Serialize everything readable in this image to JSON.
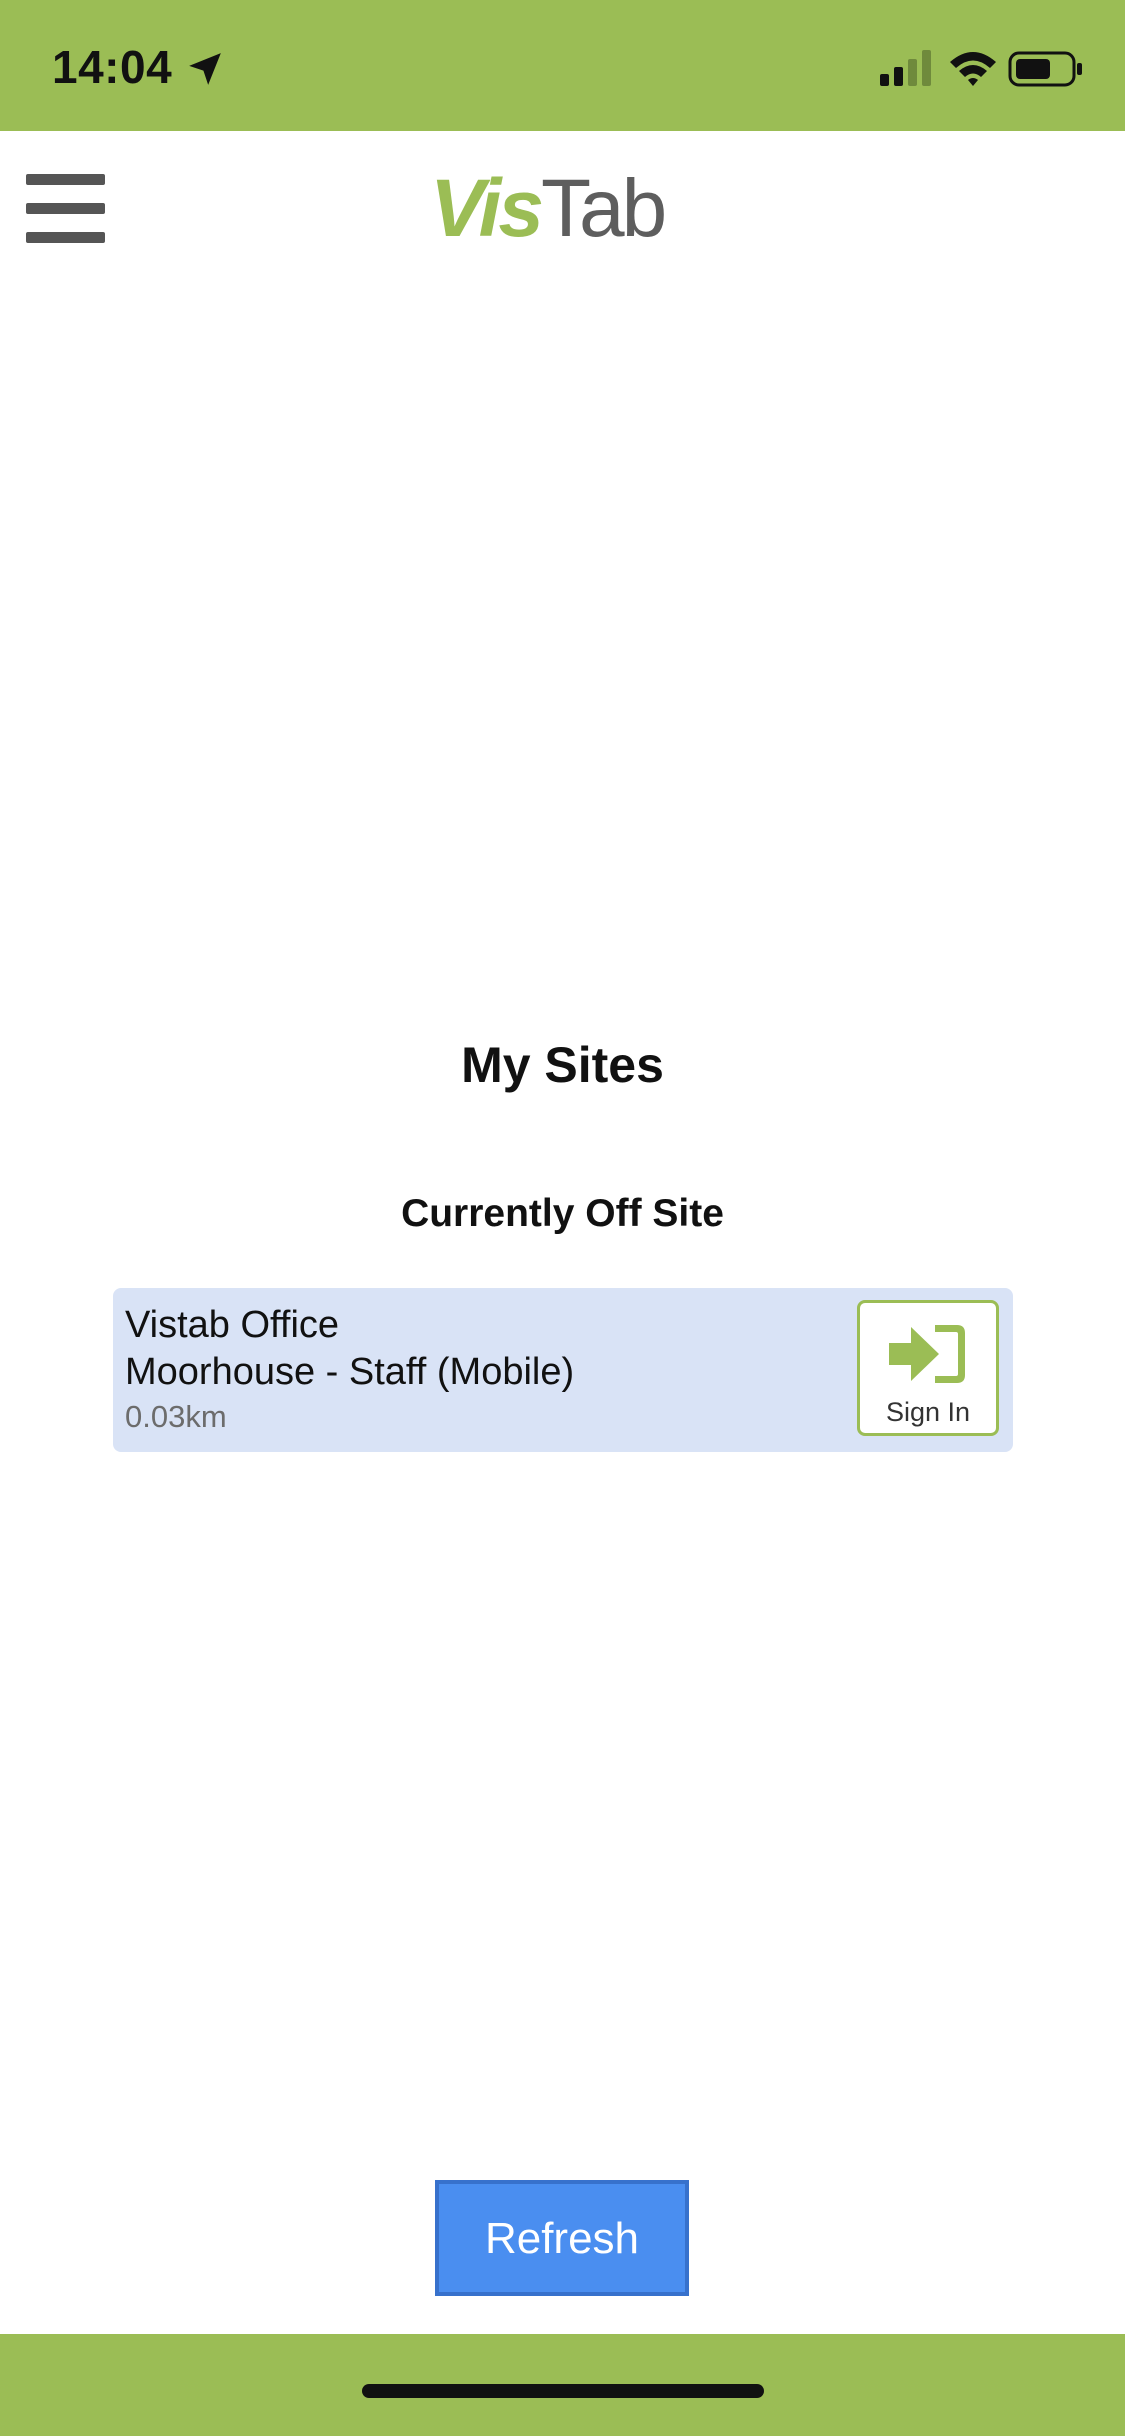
{
  "status_bar": {
    "time": "14:04",
    "icons": [
      "location-arrow-icon",
      "signal-icon",
      "wifi-icon",
      "battery-icon"
    ]
  },
  "header": {
    "menu_icon": "hamburger-menu-icon",
    "logo": {
      "part1": "Vis",
      "part2": "Tab"
    }
  },
  "main": {
    "title": "My Sites",
    "section_heading": "Currently Off Site",
    "sites": [
      {
        "name": "Vistab Office",
        "detail": "Moorhouse - Staff (Mobile)",
        "distance": "0.03km",
        "action_label": "Sign In",
        "action_icon": "sign-in-icon"
      }
    ],
    "refresh_label": "Refresh"
  },
  "colors": {
    "brand_green": "#9bbd55",
    "logo_gray": "#5e5e5e",
    "card_background": "#d9e3f6",
    "button_blue": "#4a8ef0",
    "button_border": "#3771cc"
  }
}
